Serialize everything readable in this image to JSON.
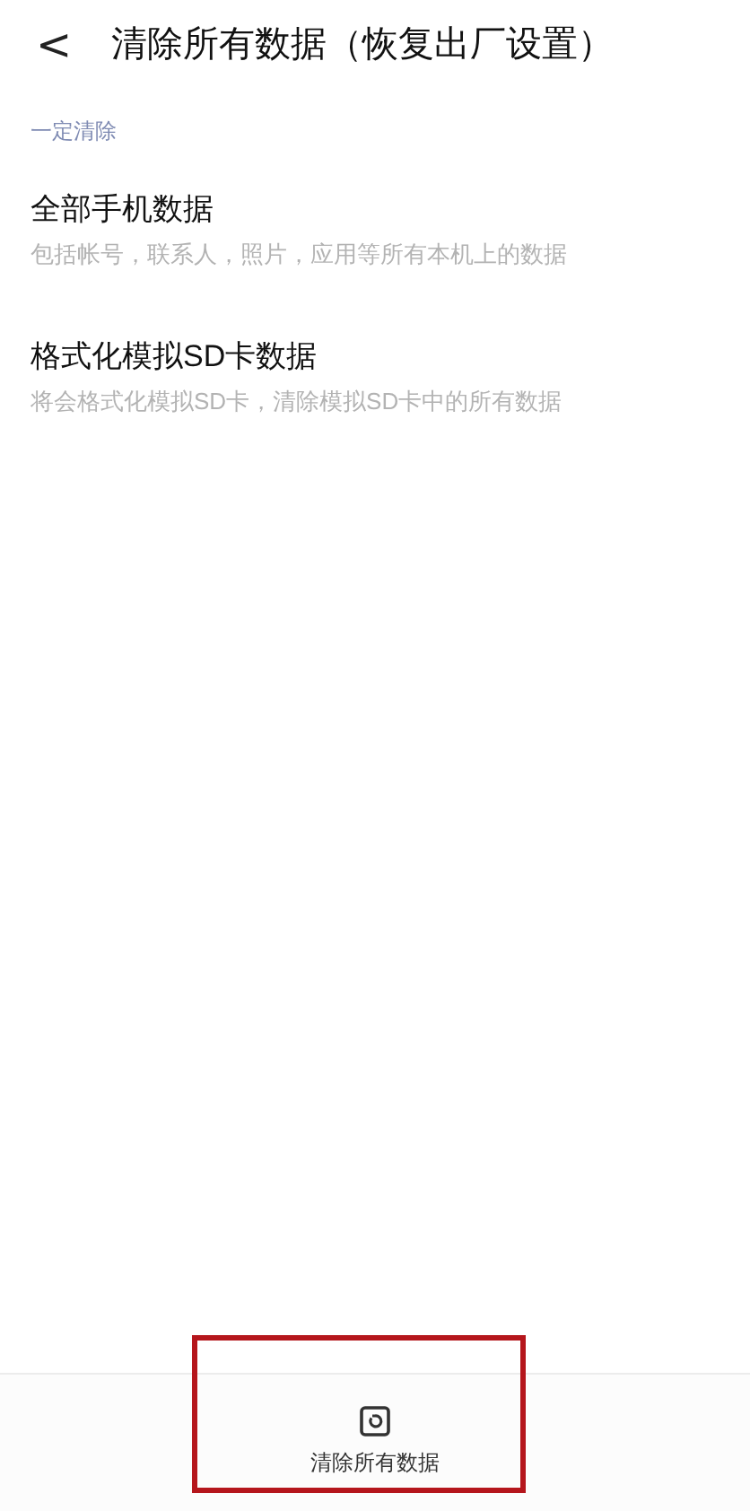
{
  "header": {
    "back": "<",
    "title": "清除所有数据（恢复出厂设置）"
  },
  "section": {
    "label": "一定清除",
    "items": [
      {
        "title": "全部手机数据",
        "subtitle": "包括帐号，联系人，照片，应用等所有本机上的数据"
      },
      {
        "title": "格式化模拟SD卡数据",
        "subtitle": "将会格式化模拟SD卡，清除模拟SD卡中的所有数据"
      }
    ]
  },
  "bottom_bar": {
    "button": {
      "label": "清除所有数据",
      "highlighted": true
    }
  }
}
